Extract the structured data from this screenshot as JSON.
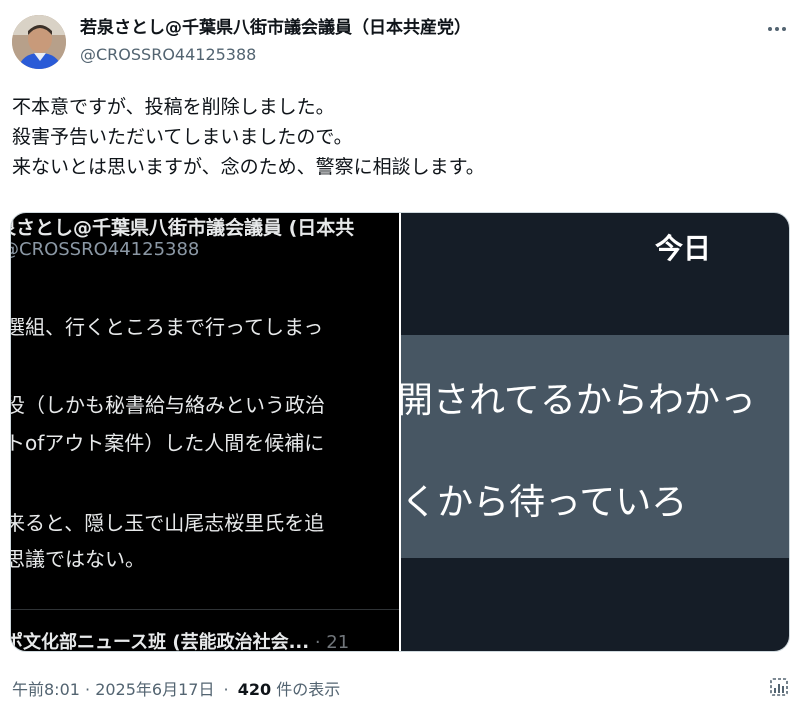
{
  "author": {
    "display_name": "若泉さとし@千葉県八街市議会議員（日本共産党）",
    "handle": "@CROSSRO44125388"
  },
  "tweet": {
    "lines": [
      "不本意ですが、投稿を削除しました。",
      "殺害予告いただいてしまいましたので。",
      "来ないとは思いますが、念のため、警察に相談します。"
    ]
  },
  "media": {
    "left_image": {
      "name": "泉さとし@千葉県八街市議会議員 (日本共",
      "handle": "@CROSSRO44125388",
      "lines": [
        "選組、行くところまで行ってしまっ",
        "役（しかも秘書給与絡みという政治",
        "トofアウト案件）した人間を候補に",
        "来ると、隠し玉で山尾志桜里氏を追",
        "思議ではない。"
      ],
      "bottom_text": "ポ文化部ニュース班 (芸能政治社会...",
      "bottom_meta": " · 21"
    },
    "right_image": {
      "header": "今日",
      "lines": [
        "開されてるからわかっ",
        "くから待っていろ"
      ]
    }
  },
  "meta": {
    "timestamp": "午前8:01 · 2025年6月17日",
    "separator": "·",
    "views_count": "420",
    "views_label": " 件の表示"
  },
  "icons": {
    "more": "more-horizontal-icon",
    "analytics": "analytics-icon"
  }
}
